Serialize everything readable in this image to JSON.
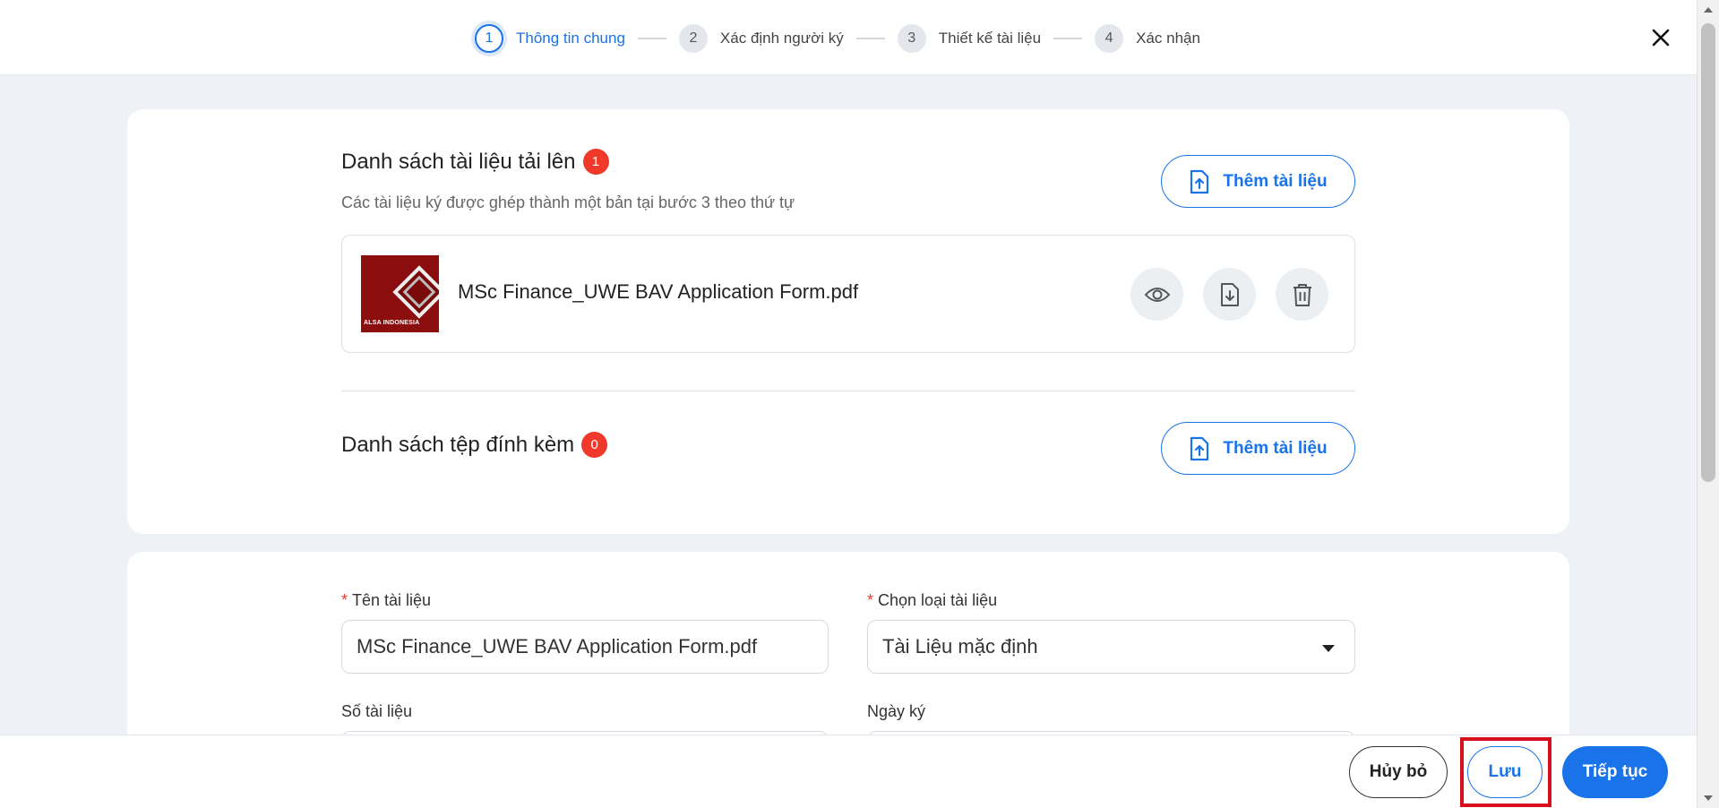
{
  "stepper": {
    "steps": [
      {
        "num": "1",
        "label": "Thông tin chung"
      },
      {
        "num": "2",
        "label": "Xác định người ký"
      },
      {
        "num": "3",
        "label": "Thiết kế tài liệu"
      },
      {
        "num": "4",
        "label": "Xác nhận"
      }
    ],
    "active_step": 1
  },
  "documents": {
    "title": "Danh sách tài liệu tải lên",
    "count": "1",
    "subtitle": "Các tài liệu ký được ghép thành một bản tại bước 3 theo thứ tự",
    "add_label": "Thêm tài liệu",
    "files": [
      {
        "name": "MSc Finance_UWE BAV Application Form.pdf",
        "thumb_text": "ALSA INDONESIA"
      }
    ]
  },
  "attachments": {
    "title": "Danh sách tệp đính kèm",
    "count": "0",
    "add_label": "Thêm tài liệu"
  },
  "form": {
    "doc_name_label": "Tên tài liệu",
    "doc_name_value": "MSc Finance_UWE BAV Application Form.pdf",
    "doc_type_label": "Chọn loại tài liệu",
    "doc_type_value": "Tài Liệu mặc định",
    "doc_number_label": "Số tài liệu",
    "sign_date_label": "Ngày ký",
    "required_mark": "*"
  },
  "footer": {
    "cancel_label": "Hủy bỏ",
    "save_label": "Lưu",
    "next_label": "Tiếp tục"
  },
  "colors": {
    "accent": "#1a73e8",
    "badge": "#f0382b",
    "highlight": "#d80e1c"
  }
}
